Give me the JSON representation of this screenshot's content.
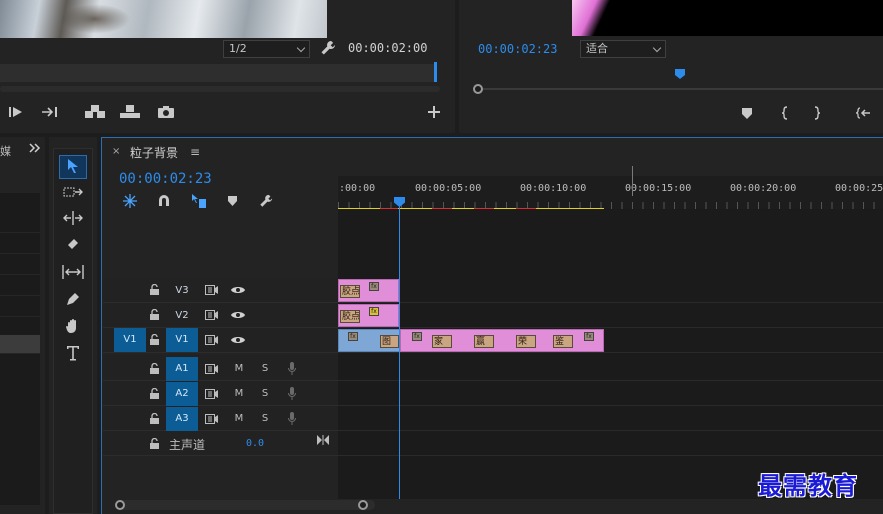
{
  "source_monitor": {
    "zoom_select": "1/2",
    "timecode": "00:00:02:00",
    "wrench_icon": "wrench-icon",
    "controls": [
      "play-icon",
      "step-forward-icon",
      "insert-icon",
      "overwrite-icon",
      "camera-icon",
      "add-icon"
    ]
  },
  "program_monitor": {
    "timecode": "00:00:02:23",
    "fit_select": "适合",
    "controls": [
      "marker-icon",
      "in-point-icon",
      "out-point-icon",
      "go-to-in-icon"
    ]
  },
  "project_panel": {
    "label_fragment": "媒",
    "expand_icon": "double-chevron-right-icon"
  },
  "tools": [
    "selection-tool-icon",
    "track-select-icon",
    "ripple-edit-icon",
    "razor-icon",
    "slip-icon",
    "pen-icon",
    "hand-icon",
    "type-icon"
  ],
  "timeline": {
    "sequence_name": "粒子背景",
    "close_symbol": "×",
    "menu_symbol": "≡",
    "playhead_timecode": "00:00:02:23",
    "ruler_labels": [
      ":00:00",
      "00:00:05:00",
      "00:00:10:00",
      "00:00:15:00",
      "00:00:20:00",
      "00:00:25:0"
    ],
    "tracks": {
      "v3": {
        "name": "V3"
      },
      "v2": {
        "name": "V2"
      },
      "v1": {
        "source": "V1",
        "name": "V1"
      },
      "a1": {
        "name": "A1",
        "mute": "M",
        "solo": "S"
      },
      "a2": {
        "name": "A2",
        "mute": "M",
        "solo": "S"
      },
      "a3": {
        "name": "A3",
        "mute": "M",
        "solo": "S"
      }
    },
    "master": {
      "label": "主声道",
      "value": "0.0"
    },
    "clips": {
      "v3_label": "胶点",
      "v2_label": "胶点",
      "v1_a": "图",
      "v1_b": "家",
      "v1_c": "赢",
      "v1_d": "荣",
      "v1_e": "鉴"
    },
    "fx_label": "fx"
  },
  "watermark": "最需教育",
  "colors": {
    "accent_blue": "#2d8ceb",
    "clip_pink": "#e08ed8",
    "clip_blue": "#7ea7d6",
    "track_on": "#0c5c96"
  }
}
